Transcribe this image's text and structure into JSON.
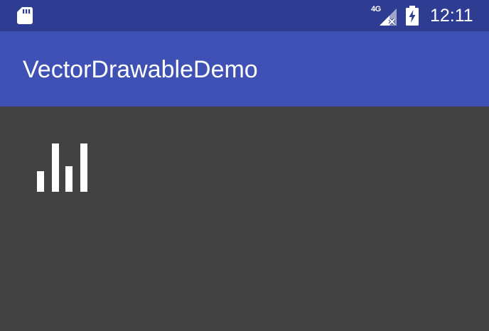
{
  "status_bar": {
    "network_type": "4G",
    "time": "12:11",
    "icons": {
      "left": "sd-card-icon",
      "network": "cellular-signal-no-data-icon",
      "battery": "battery-charging-icon"
    }
  },
  "app_bar": {
    "title": "VectorDrawableDemo",
    "color": "#3f51b5",
    "status_color": "#2e3d91"
  },
  "content": {
    "background": "#424242",
    "drawable": {
      "name": "signal-strength-bars-icon",
      "color": "#ffffff",
      "bar_levels": [
        0.42,
        1.0,
        0.53,
        1.0
      ]
    }
  }
}
